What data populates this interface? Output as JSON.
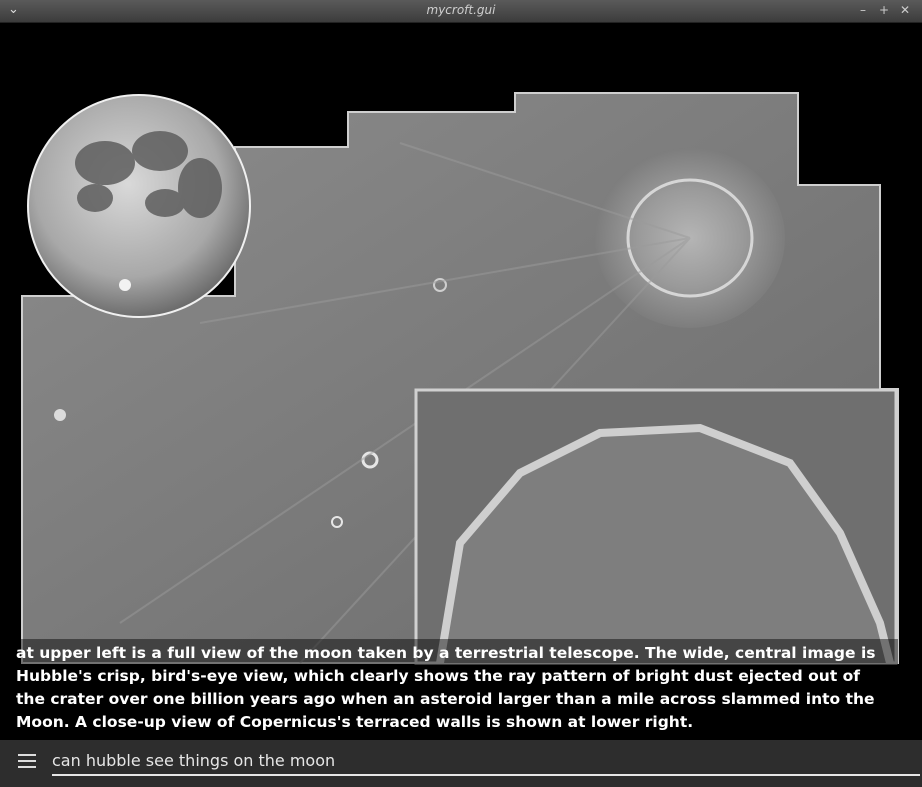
{
  "window": {
    "title": "mycroft.gui"
  },
  "article": {
    "caption": "at upper left is a full view of the moon taken by a terrestrial telescope. The wide, central image is Hubble's crisp, bird's-eye view, which clearly shows the ray pattern of bright dust ejected out of the crater over one billion years ago when an asteroid larger than a mile across slammed into the Moon. A close-up view of Copernicus's terraced walls is shown at lower right."
  },
  "input": {
    "value": "can hubble see things on the moon"
  },
  "icons": {
    "menu": "hamburger-icon",
    "window_menu": "chevron-down-icon",
    "minimize": "minimize-icon",
    "maximize": "maximize-icon",
    "close": "close-icon"
  }
}
